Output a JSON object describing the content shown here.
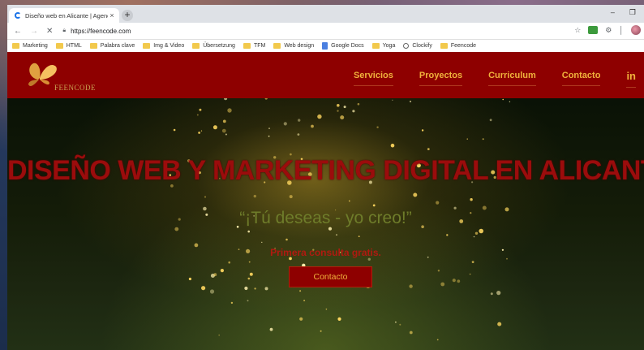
{
  "browser": {
    "tab_title": "Diseño web en Alicante | Agencia",
    "tab_close": "×",
    "new_tab": "+",
    "url": "https://feencode.com",
    "window_controls": {
      "minimize": "–",
      "restore": "❐"
    }
  },
  "bookmarks": [
    {
      "label": "Marketing",
      "icon": "folder-icon"
    },
    {
      "label": "HTML",
      "icon": "folder-icon"
    },
    {
      "label": "Palabra clave",
      "icon": "folder-icon"
    },
    {
      "label": "Img & Video",
      "icon": "folder-icon"
    },
    {
      "label": "Übersetzung",
      "icon": "folder-icon"
    },
    {
      "label": "TFM",
      "icon": "folder-icon"
    },
    {
      "label": "Web design",
      "icon": "folder-icon"
    },
    {
      "label": "Google Docs",
      "icon": "google-docs-icon"
    },
    {
      "label": "Yoga",
      "icon": "folder-icon"
    },
    {
      "label": "Clockify",
      "icon": "clockify-icon"
    },
    {
      "label": "Feencode",
      "icon": "folder-icon"
    }
  ],
  "site": {
    "logo_text": "FEENCODE",
    "nav": [
      "Servicios",
      "Proyectos",
      "Curriculum",
      "Contacto"
    ],
    "linkedin": "in",
    "hero_title": "DISEÑO WEB Y MARKETING DIGITAL EN ALICANTE",
    "hero_subtitle": "“¡Tú deseas - yo creo!”",
    "hero_note": "Primera consulta gratis.",
    "hero_button": "Contacto"
  },
  "colors": {
    "header_bg": "#8e0000",
    "nav_text": "#f0b23c",
    "title_red": "#9b0c0c",
    "subtitle_olive": "#6e7c2a"
  }
}
